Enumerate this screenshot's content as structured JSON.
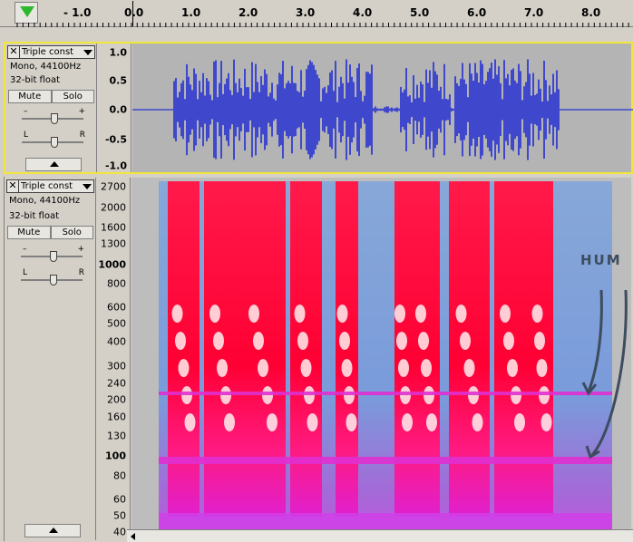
{
  "ruler": {
    "labels": [
      "- 1.0",
      "0.0",
      "1.0",
      "2.0",
      "3.0",
      "4.0",
      "5.0",
      "6.0",
      "7.0",
      "8.0"
    ]
  },
  "track1": {
    "name": "Triple const",
    "format": "Mono, 44100Hz",
    "bits": "32-bit float",
    "mute_label": "Mute",
    "solo_label": "Solo",
    "gain_minus": "–",
    "gain_plus": "+",
    "pan_l": "L",
    "pan_r": "R",
    "scale": [
      "1.0",
      "0.5",
      "0.0",
      "-0.5",
      "-1.0"
    ]
  },
  "track2": {
    "name": "Triple const",
    "format": "Mono, 44100Hz",
    "bits": "32-bit float",
    "mute_label": "Mute",
    "solo_label": "Solo",
    "gain_minus": "–",
    "gain_plus": "+",
    "pan_l": "L",
    "pan_r": "R",
    "scale": [
      "2700",
      "2000",
      "1600",
      "1300",
      "1000",
      "800",
      "600",
      "500",
      "400",
      "300",
      "240",
      "200",
      "160",
      "130",
      "100",
      "80",
      "60",
      "50",
      "40"
    ]
  },
  "annotation": {
    "label": "HUM",
    "color": "#3d4c5e"
  },
  "colors": {
    "waveform": "#3f48cc",
    "selection_border": "#f2e63a",
    "play_icon": "#2db82d"
  },
  "icons": {
    "play": "play-triangle-icon",
    "close": "close-icon",
    "dropdown": "dropdown-arrow-icon",
    "collapse": "collapse-arrow-icon",
    "scroll_left": "scroll-left-arrow-icon"
  }
}
